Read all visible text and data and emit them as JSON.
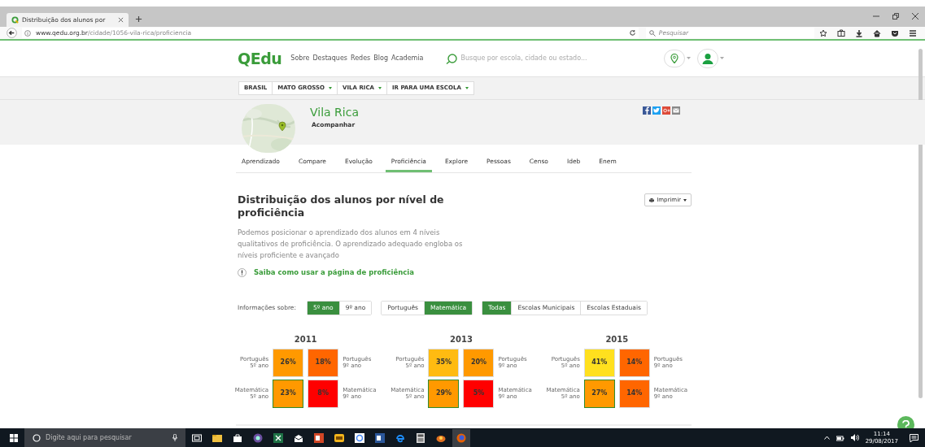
{
  "browser": {
    "tab_title": "Distribuição dos alunos por",
    "url": "**www.qedu.org.br**/cidade/1056-vila-rica/proficiencia",
    "search_placeholder": "Pesquisar"
  },
  "header": {
    "logo": "QEdu",
    "nav": [
      "Sobre",
      "Destaques",
      "Redes",
      "Blog",
      "Academia"
    ],
    "search_placeholder": "Busque por escola, cidade ou estado..."
  },
  "breadcrumb": [
    {
      "label": "BRASIL",
      "dropdown": false
    },
    {
      "label": "MATO GROSSO",
      "dropdown": true
    },
    {
      "label": "VILA RICA",
      "dropdown": true
    },
    {
      "label": "IR PARA UMA ESCOLA",
      "dropdown": true
    }
  ],
  "city": {
    "name": "Vila Rica",
    "follow": "Acompanhar"
  },
  "tabs": [
    {
      "label": "Aprendizado",
      "selected": false
    },
    {
      "label": "Compare",
      "selected": false
    },
    {
      "label": "Evolução",
      "selected": false
    },
    {
      "label": "Proficiência",
      "selected": true
    },
    {
      "label": "Explore",
      "selected": false
    },
    {
      "label": "Pessoas",
      "selected": false
    },
    {
      "label": "Censo",
      "selected": false
    },
    {
      "label": "Ideb",
      "selected": false
    },
    {
      "label": "Enem",
      "selected": false
    }
  ],
  "section": {
    "title": "Distribuição dos alunos por nível de proficiência",
    "print_button": "Imprimir",
    "description": "Podemos posicionar o aprendizado dos alunos em 4 níveis qualitativos de proficiência. O aprendizado adequado engloba os níveis proficiente e avançado",
    "help_link": "Saiba como usar a página de proficiência"
  },
  "filters": {
    "label": "Informações sobre:",
    "groups": [
      [
        {
          "label": "5º ano",
          "selected": true
        },
        {
          "label": "9º ano",
          "selected": false
        }
      ],
      [
        {
          "label": "Português",
          "selected": false
        },
        {
          "label": "Matemática",
          "selected": true
        }
      ],
      [
        {
          "label": "Todas",
          "selected": true
        },
        {
          "label": "Escolas Municipais",
          "selected": false
        },
        {
          "label": "Escolas Estaduais",
          "selected": false
        }
      ]
    ]
  },
  "years": [
    {
      "year": "2011",
      "rows": [
        [
          {
            "subject": "Português",
            "grade": "5º ano",
            "value": "26%",
            "color": "#ff9900",
            "highlighted": false
          },
          {
            "subject": "Português",
            "grade": "9º ano",
            "value": "18%",
            "color": "#ff6600",
            "highlighted": false
          }
        ],
        [
          {
            "subject": "Matemática",
            "grade": "5º ano",
            "value": "23%",
            "color": "#ff9900",
            "highlighted": true
          },
          {
            "subject": "Matemática",
            "grade": "9º ano",
            "value": "8%",
            "color": "#ff0000",
            "highlighted": false
          }
        ]
      ]
    },
    {
      "year": "2013",
      "rows": [
        [
          {
            "subject": "Português",
            "grade": "5º ano",
            "value": "35%",
            "color": "#ffbb11",
            "highlighted": false
          },
          {
            "subject": "Português",
            "grade": "9º ano",
            "value": "20%",
            "color": "#ff9900",
            "highlighted": false
          }
        ],
        [
          {
            "subject": "Matemática",
            "grade": "5º ano",
            "value": "29%",
            "color": "#ff9900",
            "highlighted": true
          },
          {
            "subject": "Matemática",
            "grade": "9º ano",
            "value": "5%",
            "color": "#ff0000",
            "highlighted": false
          }
        ]
      ]
    },
    {
      "year": "2015",
      "rows": [
        [
          {
            "subject": "Português",
            "grade": "5º ano",
            "value": "41%",
            "color": "#ffe01e",
            "highlighted": false
          },
          {
            "subject": "Português",
            "grade": "9º ano",
            "value": "14%",
            "color": "#ff6600",
            "highlighted": false
          }
        ],
        [
          {
            "subject": "Matemática",
            "grade": "5º ano",
            "value": "27%",
            "color": "#ff9900",
            "highlighted": true
          },
          {
            "subject": "Matemática",
            "grade": "9º ano",
            "value": "14%",
            "color": "#ff6600",
            "highlighted": false
          }
        ]
      ]
    }
  ],
  "taskbar": {
    "search_placeholder": "Digite aqui para pesquisar",
    "time": "11:14",
    "date": "29/08/2017"
  }
}
